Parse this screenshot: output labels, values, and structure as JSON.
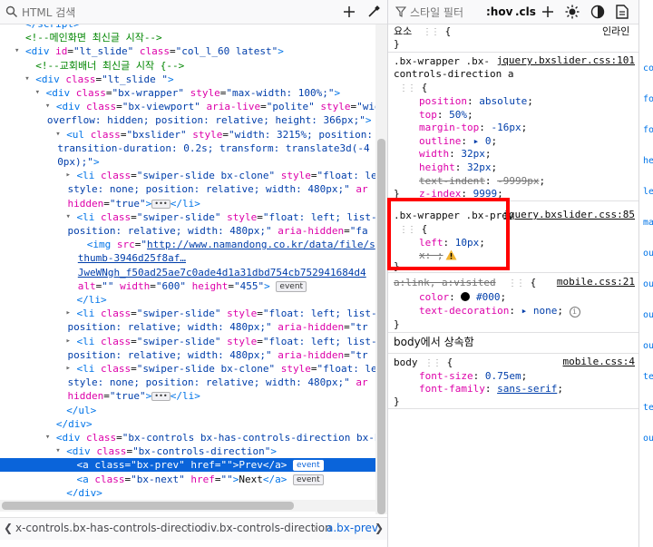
{
  "left_toolbar": {
    "search_placeholder": "HTML 검색",
    "add_icon": "plus-icon",
    "pick_icon": "eyedropper-icon"
  },
  "tree_lines": [
    {
      "indent": 5,
      "tw": "",
      "html": "<span class='tag'>&lt;/script&gt;</span>"
    },
    {
      "indent": 5,
      "tw": "",
      "html": "<span class='cmt'>&lt;!--메인화면 최신글 시작--&gt;</span>"
    },
    {
      "indent": 5,
      "tw": "▾",
      "html": "<span class='tag'>&lt;div</span> <span class='attr'>id</span>=<span class='val'>\"lt_slide\"</span> <span class='attr'>class</span>=<span class='val'>\"col_l_60 latest\"</span><span class='tag'>&gt;</span>"
    },
    {
      "indent": 6,
      "tw": "",
      "html": "<span class='cmt'>&lt;!--교회배너 최신글 시작 {--&gt;</span>"
    },
    {
      "indent": 6,
      "tw": "▾",
      "html": "<span class='tag'>&lt;div</span> <span class='attr'>class</span>=<span class='val'>\"lt_slide \"</span><span class='tag'>&gt;</span>"
    },
    {
      "indent": 7,
      "tw": "▾",
      "html": "<span class='tag'>&lt;div</span> <span class='attr'>class</span>=<span class='val'>\"bx-wrapper\"</span> <span class='attr'>style</span>=<span class='val'>\"max-width: 100%;\"</span><span class='tag'>&gt;</span>"
    },
    {
      "indent": 8,
      "tw": "▾",
      "html": "<span class='tag'>&lt;div</span> <span class='attr'>class</span>=<span class='val'>\"bx-viewport\"</span> <span class='attr'>aria-live</span>=<span class='val'>\"polite\"</span> <span class='attr'>style</span>=<span class='val'>\"wid</span>"
    },
    {
      "indent": 8,
      "tw": "",
      "cont": true,
      "html": "<span class='val'>overflow: hidden; position: relative; height: 366px;\"</span><span class='tag'>&gt;</span>"
    },
    {
      "indent": 9,
      "tw": "▾",
      "html": "<span class='tag'>&lt;ul</span> <span class='attr'>class</span>=<span class='val'>\"bxslider\"</span> <span class='attr'>style</span>=<span class='val'>\"width: 3215%; position: </span>"
    },
    {
      "indent": 9,
      "tw": "",
      "cont": true,
      "html": "<span class='val'>transition-duration: 0.2s; transform: translate3d(-4</span>"
    },
    {
      "indent": 9,
      "tw": "",
      "cont": true,
      "html": "<span class='val'>0px);\"</span><span class='tag'>&gt;</span>"
    },
    {
      "indent": 10,
      "tw": "▸",
      "html": "<span class='tag'>&lt;li</span> <span class='attr'>class</span>=<span class='val'>\"swiper-slide bx-clone\"</span> <span class='attr'>style</span>=<span class='val'>\"float: le</span>"
    },
    {
      "indent": 10,
      "tw": "",
      "cont": true,
      "html": "<span class='val'>style: none; position: relative; width: 480px;\"</span> <span class='attr'>ar</span>"
    },
    {
      "indent": 10,
      "tw": "",
      "cont": true,
      "html": "<span class='attr'>hidden</span>=<span class='val'>\"true\"</span><span class='tag'>&gt;</span><span class='ell'>•••</span><span class='tag'>&lt;/li&gt;</span>"
    },
    {
      "indent": 10,
      "tw": "▾",
      "html": "<span class='tag'>&lt;li</span> <span class='attr'>class</span>=<span class='val'>\"swiper-slide\"</span> <span class='attr'>style</span>=<span class='val'>\"float: left; list-</span>"
    },
    {
      "indent": 10,
      "tw": "",
      "cont": true,
      "html": "<span class='val'>position: relative; width: 480px;\"</span> <span class='attr'>aria-hidden</span>=<span class='val'>\"fa</span>"
    },
    {
      "indent": 11,
      "tw": "",
      "html": "<span class='tag'>&lt;img</span> <span class='attr'>src</span>=<span class='val'>\"</span><span class='link'>http://www.namandong.co.kr/data/file/s</span>"
    },
    {
      "indent": 11,
      "tw": "",
      "cont": true,
      "html": "<span class='link'>thumb-3946d25f8af…</span>"
    },
    {
      "indent": 11,
      "tw": "",
      "cont": true,
      "html": "<span class='link'>JweWNgh_f50ad25ae7c0ade4d1a31dbd754cb752941684d4</span>"
    },
    {
      "indent": 11,
      "tw": "",
      "cont": true,
      "html": "<span class='attr'>alt</span>=<span class='val'>\"\"</span> <span class='attr'>width</span>=<span class='val'>\"600\"</span> <span class='attr'>height</span>=<span class='val'>\"455\"</span><span class='tag'>&gt;</span> <span class='badge'>event</span>"
    },
    {
      "indent": 10,
      "tw": "",
      "html": "<span class='tag'>&lt;/li&gt;</span>"
    },
    {
      "indent": 10,
      "tw": "▸",
      "html": "<span class='tag'>&lt;li</span> <span class='attr'>class</span>=<span class='val'>\"swiper-slide\"</span> <span class='attr'>style</span>=<span class='val'>\"float: left; list-</span>"
    },
    {
      "indent": 10,
      "tw": "",
      "cont": true,
      "html": "<span class='val'>position: relative; width: 480px;\"</span> <span class='attr'>aria-hidden</span>=<span class='val'>\"tr</span>"
    },
    {
      "indent": 10,
      "tw": "▸",
      "html": "<span class='tag'>&lt;li</span> <span class='attr'>class</span>=<span class='val'>\"swiper-slide\"</span> <span class='attr'>style</span>=<span class='val'>\"float: left; list-</span>"
    },
    {
      "indent": 10,
      "tw": "",
      "cont": true,
      "html": "<span class='val'>position: relative; width: 480px;\"</span> <span class='attr'>aria-hidden</span>=<span class='val'>\"tr</span>"
    },
    {
      "indent": 10,
      "tw": "▸",
      "html": "<span class='tag'>&lt;li</span> <span class='attr'>class</span>=<span class='val'>\"swiper-slide bx-clone\"</span> <span class='attr'>style</span>=<span class='val'>\"float: le</span>"
    },
    {
      "indent": 10,
      "tw": "",
      "cont": true,
      "html": "<span class='val'>style: none; position: relative; width: 480px;\"</span> <span class='attr'>ar</span>"
    },
    {
      "indent": 10,
      "tw": "",
      "cont": true,
      "html": "<span class='attr'>hidden</span>=<span class='val'>\"true\"</span><span class='tag'>&gt;</span><span class='ell'>•••</span><span class='tag'>&lt;/li&gt;</span>"
    },
    {
      "indent": 9,
      "tw": "",
      "html": "<span class='tag'>&lt;/ul&gt;</span>"
    },
    {
      "indent": 8,
      "tw": "",
      "html": "<span class='tag'>&lt;/div&gt;</span>"
    },
    {
      "indent": 8,
      "tw": "▾",
      "html": "<span class='tag'>&lt;div</span> <span class='attr'>class</span>=<span class='val'>\"bx-controls bx-has-controls-direction bx-h</span>"
    },
    {
      "indent": 9,
      "tw": "▾",
      "html": "<span class='tag'>&lt;div</span> <span class='attr'>class</span>=<span class='val'>\"bx-controls-direction\"</span><span class='tag'>&gt;</span>"
    },
    {
      "indent": 10,
      "tw": "",
      "selected": true,
      "html": "<span class='tag'>&lt;a</span> <span class='attr'>class</span>=<span class='val'>\"bx-prev\"</span> <span class='attr'>href</span>=<span class='val'>\"\"</span><span class='tag'>&gt;</span><span class='txt'>Prev</span><span class='tag'>&lt;/a&gt;</span> <span class='badge'>event</span>"
    },
    {
      "indent": 10,
      "tw": "",
      "html": "<span class='tag'>&lt;a</span> <span class='attr'>class</span>=<span class='val'>\"bx-next\"</span> <span class='attr'>href</span>=<span class='val'>\"\"</span><span class='tag'>&gt;</span><span class='txt'>Next</span><span class='tag'>&lt;/a&gt;</span> <span class='badge'>event</span>"
    },
    {
      "indent": 9,
      "tw": "",
      "html": "<span class='tag'>&lt;/div&gt;</span>"
    }
  ],
  "breadcrumb": {
    "items": [
      "x-controls.bx-has-controls-directio",
      "div.bx-controls-direction",
      "a.bx-prev"
    ]
  },
  "right_toolbar": {
    "filter_placeholder": "스타일 필터",
    "hov": ":hov",
    "cls": ".cls"
  },
  "rules": {
    "element_label": "요소",
    "inline_label": "인라인",
    "r1_sel1": ".bx-wrapper .bx-",
    "r1_sel2": "controls-direction a",
    "r1_src": "jquery.bxslider.css:101",
    "r1_props": [
      {
        "name": "position",
        "value": "absolute",
        "strike": false
      },
      {
        "name": "top",
        "value": "50%",
        "strike": false
      },
      {
        "name": "margin-top",
        "value": "-16px",
        "strike": false
      },
      {
        "name": "outline",
        "value": "▸ 0",
        "strike": false
      },
      {
        "name": "width",
        "value": "32px",
        "strike": false
      },
      {
        "name": "height",
        "value": "32px",
        "strike": false
      },
      {
        "name": "text-indent",
        "value": "-9999px",
        "strike": true
      },
      {
        "name": "z-index",
        "value": "9999",
        "strike": false
      }
    ],
    "r2_sel": ".bx-wrapper .bx-prev",
    "r2_src": "jquery.bxslider.css:85",
    "r2_left_name": "left",
    "r2_left_value": "10px",
    "r2_x": "x: ;",
    "r3_sel": "a:link, a:visited",
    "r3_src": "mobile.css:21",
    "r3_color_name": "color",
    "r3_color_value": "#000",
    "r3_td_name": "text-decoration",
    "r3_td_value": "▸ none",
    "inherited_title": "body에서 상속함",
    "r4_sel": "body",
    "r4_src": "mobile.css:4",
    "r4_fs_name": "font-size",
    "r4_fs_value": "0.75em",
    "r4_ff_name": "font-family",
    "r4_ff_value": "sans-serif"
  },
  "far_right": [
    "co",
    "fo",
    "fo",
    "he",
    "le",
    "ma",
    "ou",
    "ou",
    "ou",
    "ou",
    "te",
    "te",
    "ou"
  ],
  "colors": {
    "selection": "#0a64da",
    "highlight_box": "#ff0000",
    "warning": "#f1b32f"
  }
}
